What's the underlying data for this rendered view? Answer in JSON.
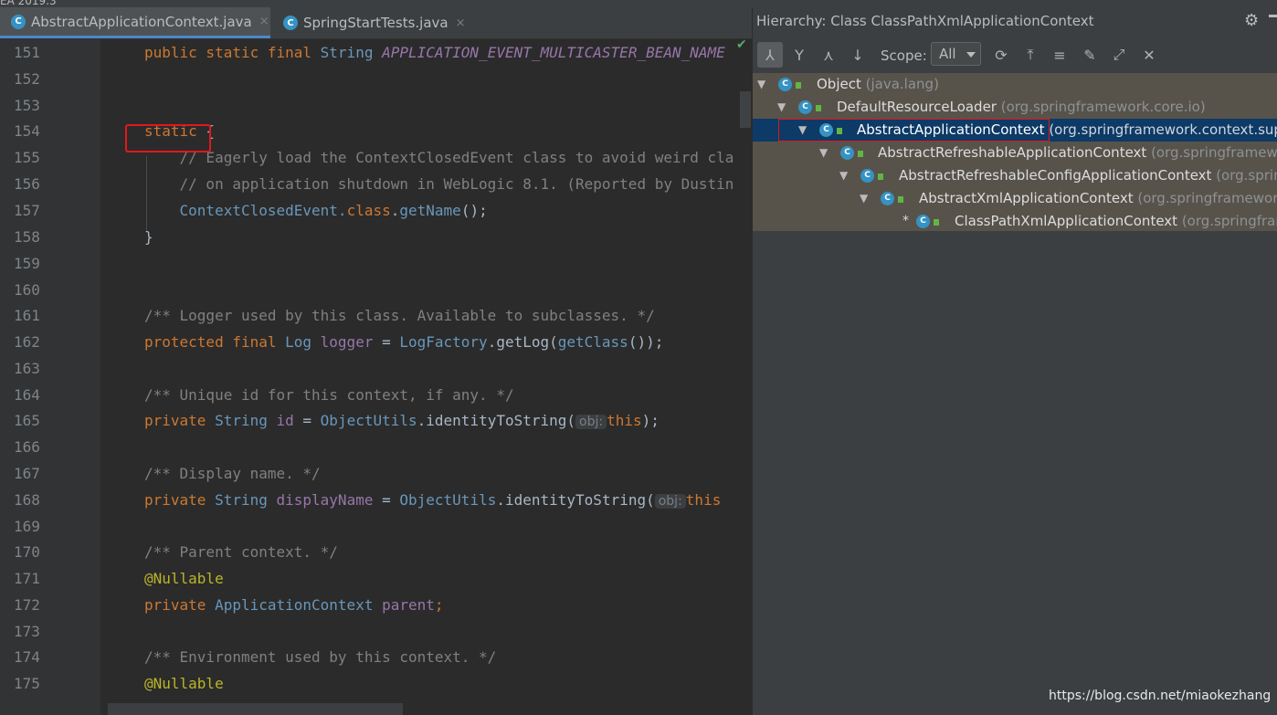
{
  "window": {
    "title_fragment": "EA 2019.3"
  },
  "tabs": [
    {
      "label": "AbstractApplicationContext.java",
      "close": "×",
      "active": true
    },
    {
      "label": "SpringStartTests.java",
      "close": "×",
      "active": false
    }
  ],
  "editor": {
    "lines": [
      {
        "num": "151"
      },
      {
        "num": "152"
      },
      {
        "num": "153"
      },
      {
        "num": "154"
      },
      {
        "num": "155"
      },
      {
        "num": "156"
      },
      {
        "num": "157"
      },
      {
        "num": "158"
      },
      {
        "num": "159"
      },
      {
        "num": "160"
      },
      {
        "num": "161"
      },
      {
        "num": "162"
      },
      {
        "num": "163"
      },
      {
        "num": "164"
      },
      {
        "num": "165"
      },
      {
        "num": "166"
      },
      {
        "num": "167"
      },
      {
        "num": "168"
      },
      {
        "num": "169"
      },
      {
        "num": "170"
      },
      {
        "num": "171"
      },
      {
        "num": "172"
      },
      {
        "num": "173"
      },
      {
        "num": "174"
      },
      {
        "num": "175"
      }
    ],
    "code": {
      "l151_kw": "public static final ",
      "l151_type": "String ",
      "l151_const": "APPLICATION_EVENT_MULTICASTER_BEAN_NAME",
      "l154_kw": "static",
      "l154_brace": " {",
      "l155": "    // Eagerly load the ContextClosedEvent class to avoid weird cla",
      "l156": "    // on application shutdown in WebLogic 8.1. (Reported by Dustin",
      "l157_a": "    ContextClosedEvent.",
      "l157_kw": "class",
      "l157_b": ".",
      "l157_m": "getName",
      "l157_c": "();",
      "l158": "}",
      "l161": "/** Logger used by this class. Available to subclasses. */",
      "l162_kw": "protected final ",
      "l162_type": "Log ",
      "l162_var": "logger",
      "l162_eq": " = ",
      "l162_cls": "LogFactory",
      "l162_dot": ".getLog(",
      "l162_call": "getClass",
      "l162_end": "());",
      "l164": "/** Unique id for this context, if any. */",
      "l165_kw": "private ",
      "l165_type": "String ",
      "l165_var": "id",
      "l165_eq": " = ",
      "l165_cls": "ObjectUtils",
      "l165_m": ".identityToString(",
      "l165_hint": "obj:",
      "l165_this": "this",
      "l165_end": ");",
      "l167": "/** Display name. */",
      "l168_kw": "private ",
      "l168_type": "String ",
      "l168_var": "displayName",
      "l168_eq": " = ",
      "l168_cls": "ObjectUtils",
      "l168_m": ".identityToString(",
      "l168_hint": "obj:",
      "l168_this": "this",
      "l170": "/** Parent context. */",
      "l171": "@Nullable",
      "l172_kw": "private ",
      "l172_type": "ApplicationContext ",
      "l172_var": "parent",
      "l172_end": ";",
      "l174": "/** Environment used by this context. */",
      "l175": "@Nullable"
    }
  },
  "hierarchy": {
    "title": "Hierarchy:  Class ClassPathXmlApplicationContext",
    "scope_label": "Scope:",
    "scope_value": "All",
    "nodes": [
      {
        "name": "Object",
        "pkg": " (java.lang)"
      },
      {
        "name": "DefaultResourceLoader",
        "pkg": " (org.springframework.core.io)"
      },
      {
        "name": "AbstractApplicationContext",
        "pkg": " (org.springframework.context.supp"
      },
      {
        "name": "AbstractRefreshableApplicationContext",
        "pkg": " (org.springframewo"
      },
      {
        "name": "AbstractRefreshableConfigApplicationContext",
        "pkg": " (org.spring"
      },
      {
        "name": "AbstractXmlApplicationContext",
        "pkg": " (org.springframework"
      },
      {
        "name": "ClassPathXmlApplicationContext",
        "pkg": " (org.springfram",
        "marker": "*"
      }
    ]
  },
  "watermark": "https://blog.csdn.net/miaokezhang",
  "icons": [
    "java-class-icon",
    "close-icon",
    "gear-icon",
    "minimize-icon",
    "subtypes-icon",
    "supertypes-icon",
    "class-hierarchy-icon",
    "sort-icon",
    "refresh-icon",
    "export-icon",
    "expand-all-icon",
    "pin-icon",
    "autoscroll-icon",
    "close-panel-icon"
  ]
}
